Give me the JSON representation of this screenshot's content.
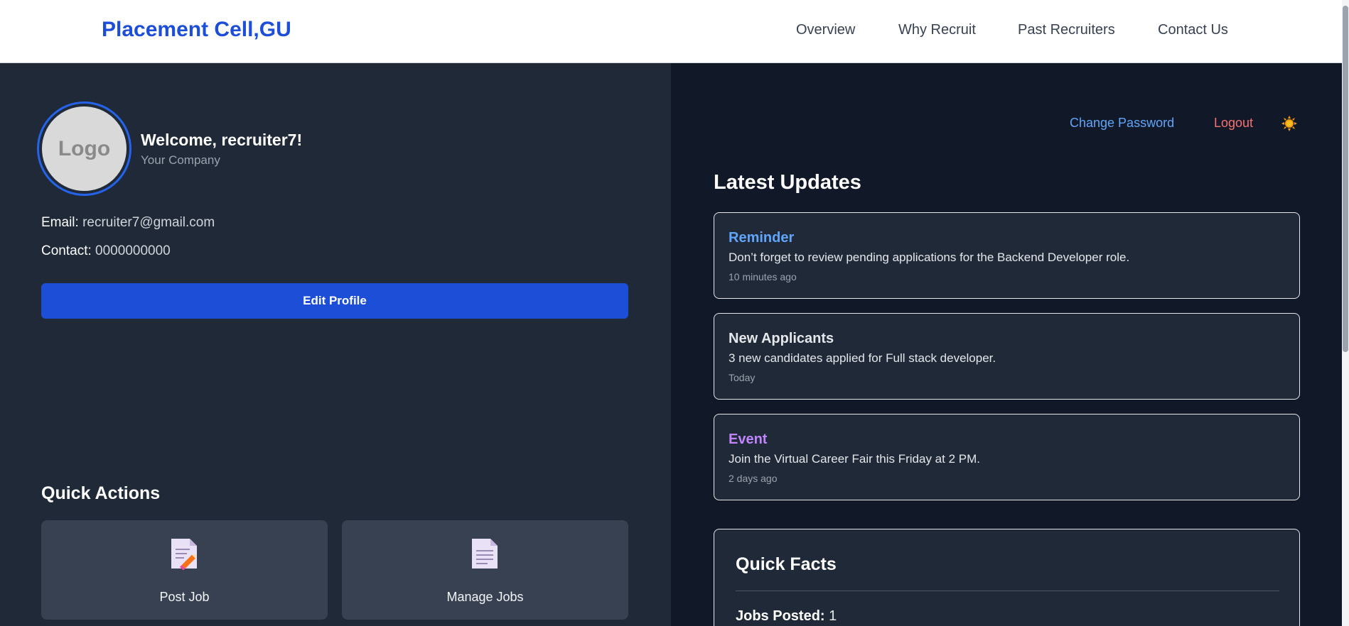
{
  "header": {
    "brand": "Placement Cell,GU",
    "nav": [
      "Overview",
      "Why Recruit",
      "Past Recruiters",
      "Contact Us"
    ]
  },
  "profile": {
    "logo_text": "Logo",
    "welcome": "Welcome, recruiter7!",
    "company": "Your Company",
    "email_label": "Email:",
    "email": "recruiter7@gmail.com",
    "contact_label": "Contact:",
    "contact": "0000000000",
    "edit_label": "Edit Profile"
  },
  "quick_actions": {
    "title": "Quick Actions",
    "items": [
      {
        "label": "Post Job",
        "icon": "document-edit-icon"
      },
      {
        "label": "Manage Jobs",
        "icon": "document-icon"
      }
    ]
  },
  "account": {
    "change_password": "Change Password",
    "logout": "Logout",
    "theme_icon": "sun-icon"
  },
  "updates": {
    "title": "Latest Updates",
    "items": [
      {
        "title": "Reminder",
        "message": "Don’t forget to review pending applications for the Backend Developer role.",
        "time": "10 minutes ago",
        "color": "#60a5fa"
      },
      {
        "title": "New Applicants",
        "message": "3 new candidates applied for Full stack developer.",
        "time": "Today",
        "color": "#e5e7eb"
      },
      {
        "title": "Event",
        "message": "Join the Virtual Career Fair this Friday at 2 PM.",
        "time": "2 days ago",
        "color": "#c084fc"
      }
    ]
  },
  "facts": {
    "title": "Quick Facts",
    "jobs_posted_label": "Jobs Posted:",
    "jobs_posted": "1"
  },
  "colors": {
    "brand": "#1d4ed8",
    "link": "#60a5fa",
    "danger": "#f87171",
    "panel_left": "#1f2937",
    "panel_right": "#111827"
  }
}
